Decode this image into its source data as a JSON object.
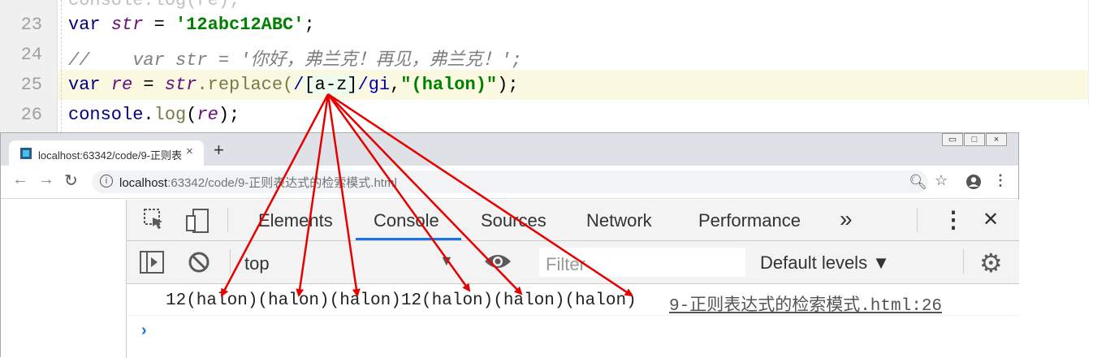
{
  "editor": {
    "lines": [
      {
        "no": "23"
      },
      {
        "no": "24",
        "comment": "//    var str = '你好，弗兰克！再见，弗兰克！';"
      },
      {
        "no": "25"
      },
      {
        "no": "26"
      }
    ],
    "line23": {
      "kw": "var",
      "name": "str",
      "eq": " = ",
      "value": "'12abc12ABC'",
      "end": ";"
    },
    "line25": {
      "kw": "var",
      "name": "re",
      "eq": " = ",
      "obj": "str",
      "method": ".replace(",
      "regex_open": "/",
      "regex_body": "[a-z]",
      "regex_close": "/",
      "flags": "gi",
      "comma": ",",
      "replacement": "\"(halon)\"",
      "end": ");"
    },
    "line26": {
      "obj": "console",
      "dot": ".",
      "method": "log",
      "open": "(",
      "arg": "re",
      "end": ");"
    }
  },
  "browser": {
    "tab_title": "localhost:63342/code/9-正则表",
    "tab_close": "×",
    "new_tab": "+",
    "url_host": "localhost",
    "url_rest": ":63342/code/9-正则表达式的检索模式.html",
    "win_controls": [
      "▭",
      "□",
      "×"
    ]
  },
  "devtools": {
    "tabs": [
      "Elements",
      "Console",
      "Sources",
      "Network",
      "Performance"
    ],
    "more": "»",
    "menu": "⋮",
    "close": "✕",
    "context": "top",
    "filter_placeholder": "Filter",
    "levels": "Default levels ▼",
    "log_message": "12(halon)(halon)(halon)12(halon)(halon)(halon)",
    "log_source": "9-正则表达式的检索模式.html:26",
    "prompt": "›"
  },
  "colors": {
    "arrow": "#e60000",
    "active_tab_underline": "#1a73e8"
  },
  "icons": [
    "inspect-icon",
    "device-icon",
    "sidebar-toggle-icon",
    "clear-console-icon",
    "eye-icon",
    "settings-gear-icon",
    "back-arrow-icon",
    "forward-arrow-icon",
    "reload-icon",
    "zoom-icon",
    "star-icon",
    "account-icon",
    "kebab-menu-icon",
    "info-icon"
  ]
}
